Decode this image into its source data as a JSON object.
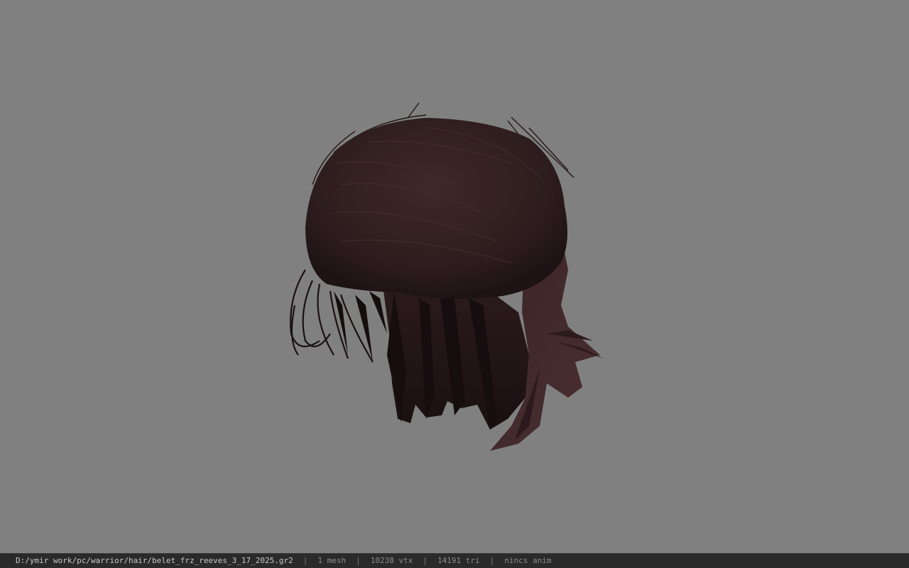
{
  "viewer": {
    "background_color": "#808080",
    "model_kind": "hair-mesh",
    "hair_color": "#3a2526"
  },
  "statusbar": {
    "file_path": "D:/ymir work/pc/warrior/hair/belet_frz_reeves_3_17_2025.gr2",
    "separator": "|",
    "mesh_count": "1 mesh",
    "vertex_count": "10238 vtx",
    "triangle_count": "14191 tri",
    "anim_status": "nincs anim"
  }
}
